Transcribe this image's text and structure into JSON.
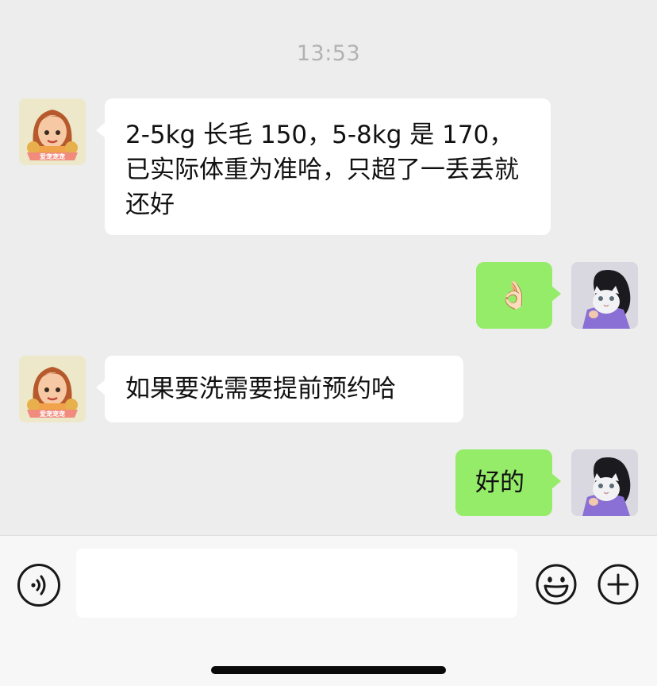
{
  "timestamp": "13:53",
  "messages": [
    {
      "side": "in",
      "text": "2-5kg 长毛 150，5-8kg 是 170，已实际体重为准哈，只超了一丢丢就还好",
      "avatar": "shop-avatar-cartoon-girl-icon"
    },
    {
      "side": "out",
      "emoji": "👌🏻",
      "avatar": "user-avatar-white-cat-icon"
    },
    {
      "side": "in",
      "text": "如果要洗需要提前预约哈",
      "avatar": "shop-avatar-cartoon-girl-icon"
    },
    {
      "side": "out",
      "text": "好的",
      "avatar": "user-avatar-white-cat-icon"
    }
  ],
  "shop_avatar_text": "爱宠宠宠",
  "input": {
    "value": "",
    "placeholder": ""
  },
  "toolbar": {
    "voice_icon": "voice-icon",
    "emoji_icon": "emoji-icon",
    "plus_icon": "plus-icon"
  },
  "colors": {
    "background": "#ededed",
    "incoming_bubble": "#ffffff",
    "outgoing_bubble": "#95ec69",
    "timestamp": "#b2b2b2"
  }
}
